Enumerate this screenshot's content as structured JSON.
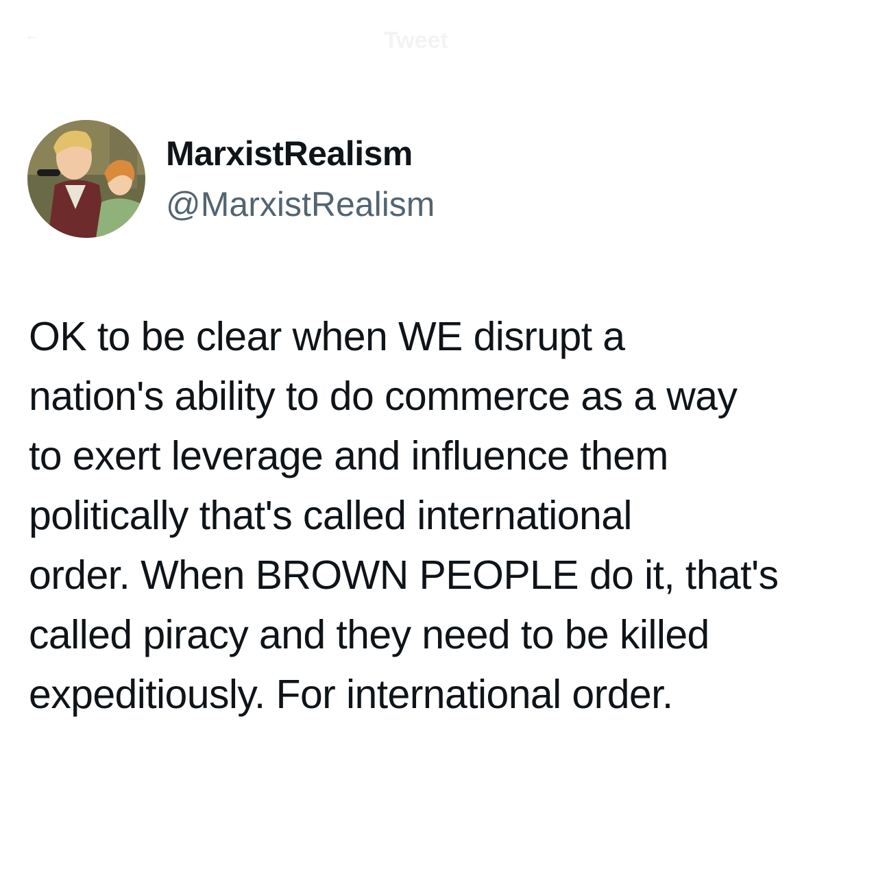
{
  "header": {
    "back_icon": "back-arrow-icon",
    "title": "Tweet"
  },
  "author": {
    "display_name": "MarxistRealism",
    "handle": "@MarxistRealism",
    "avatar_icon": "profile-avatar"
  },
  "tweet": {
    "lines": [
      "OK to be clear when WE disrupt a",
      "nation's ability to do commerce as a way",
      "to exert leverage and influence them",
      "politically that's called international",
      "order. When BROWN PEOPLE do it, that's",
      "called piracy and they need to be killed",
      "expeditiously. For international order."
    ]
  },
  "colors": {
    "text": "#0f1419",
    "secondary": "#536471",
    "background": "#ffffff"
  }
}
